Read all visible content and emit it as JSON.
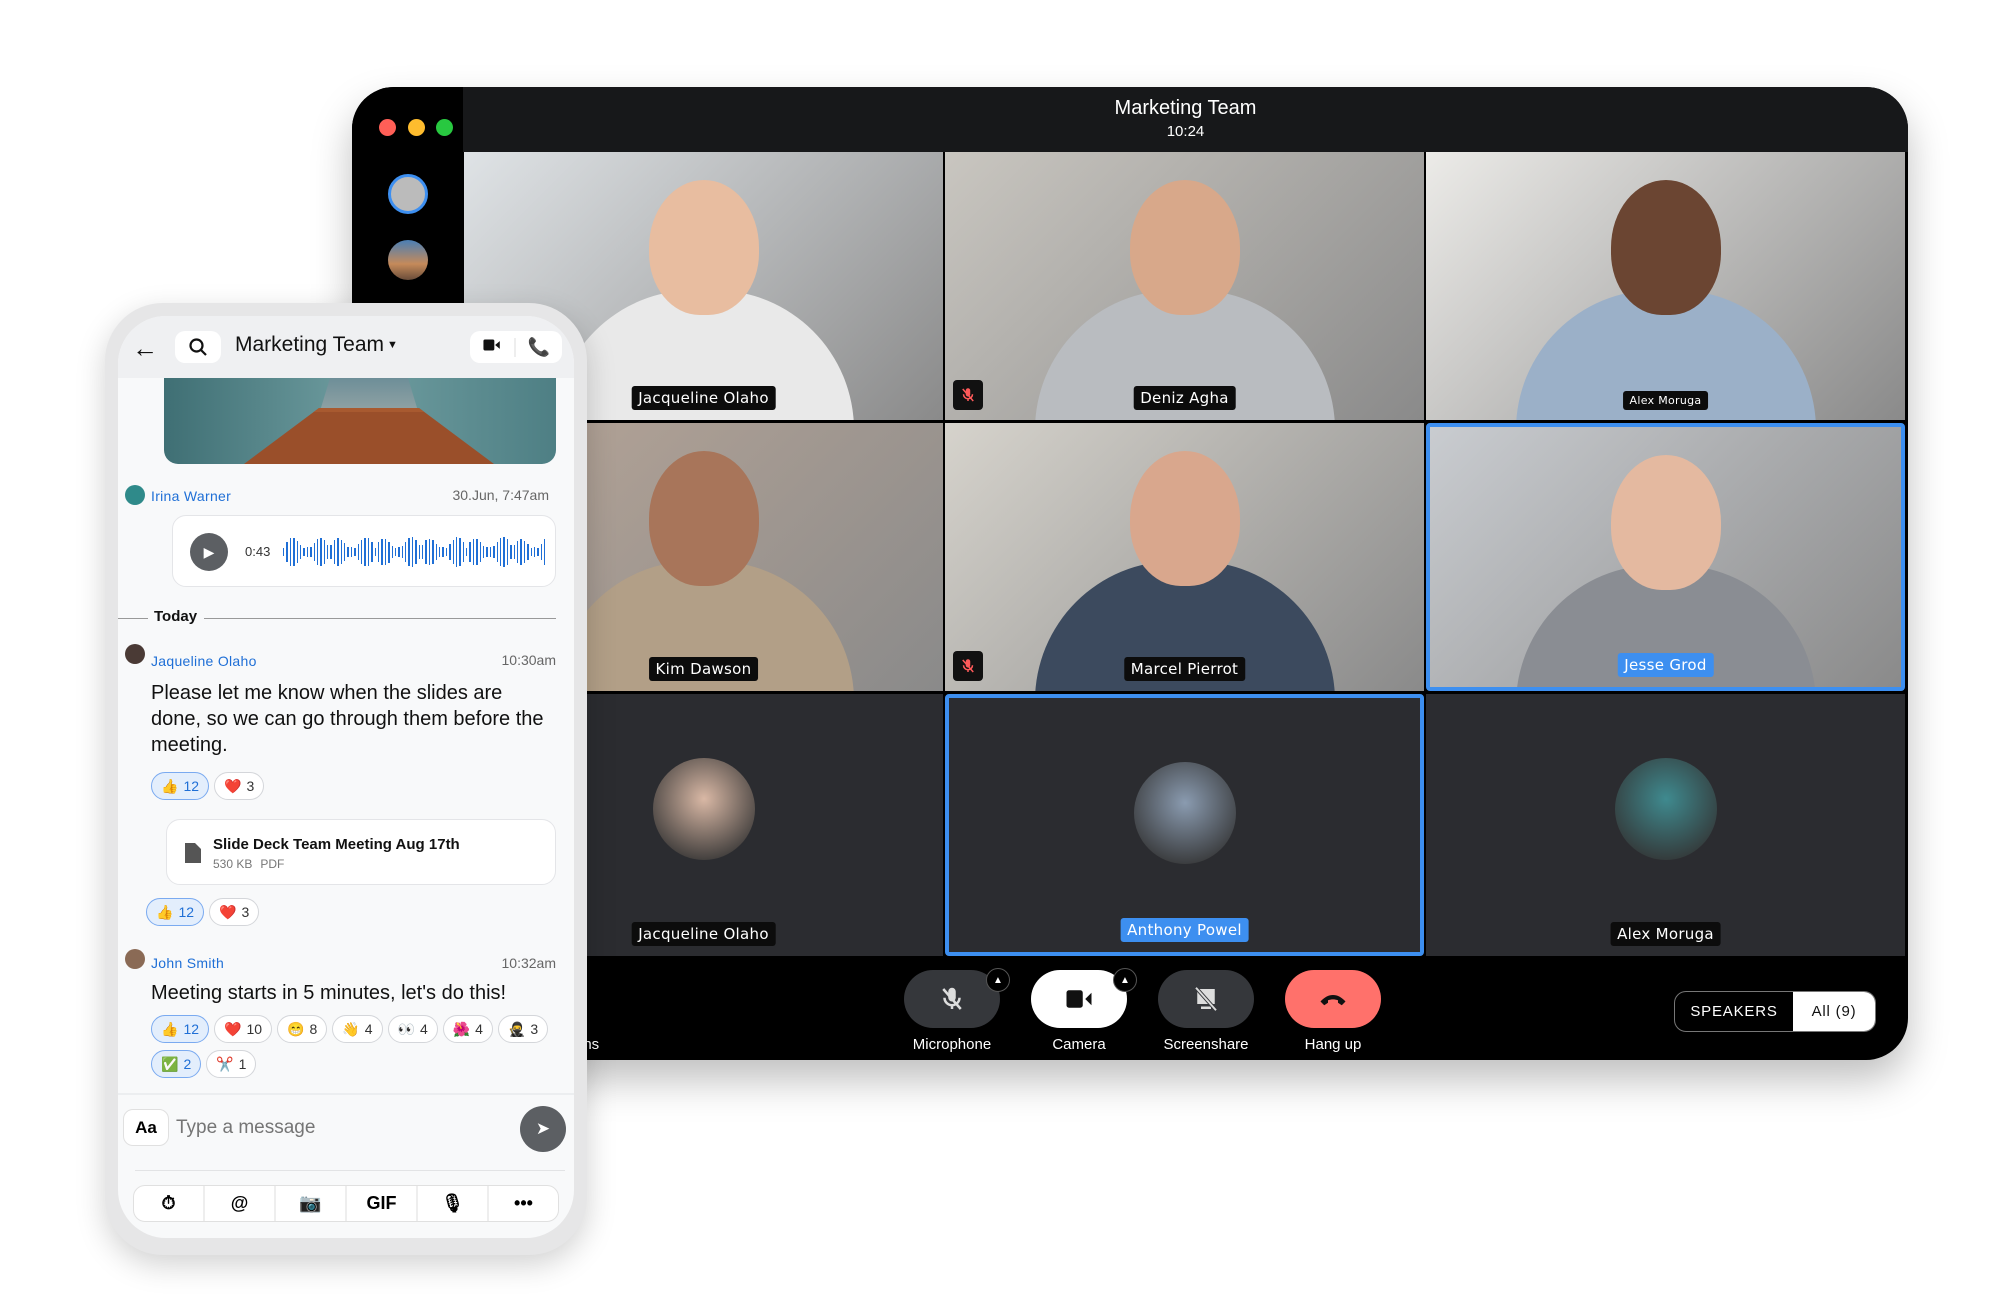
{
  "window": {
    "title": "Marketing Team",
    "time": "10:24",
    "traffic_lights": [
      "#ff5f57",
      "#febc2e",
      "#28c840"
    ]
  },
  "tiles": [
    {
      "name": "Jacqueline Olaho",
      "muted": false,
      "bg": "#dfe3e6",
      "skin": "#e8bda0",
      "shirt": "#e9e9e9"
    },
    {
      "name": "Deniz Agha",
      "muted": true,
      "bg": "#c9c6c0",
      "skin": "#d8a88a",
      "shirt": "#b9bcc0"
    },
    {
      "name": "Alex Moruga",
      "muted": false,
      "bg": "#ecebe8",
      "skin": "#6b4532",
      "shirt": "#9bb0c8"
    },
    {
      "name": "Kim Dawson",
      "muted": false,
      "bg": "#b7a597",
      "skin": "#a8755a",
      "shirt": "#b29f87"
    },
    {
      "name": "Marcel Pierrot",
      "muted": true,
      "bg": "#d6d3cc",
      "skin": "#d9a78d",
      "shirt": "#3c4a5e"
    },
    {
      "name": "Jesse Grod",
      "muted": false,
      "selected": true,
      "bg": "#c9ccd0",
      "skin": "#e4b9a0",
      "shirt": "#8a8d93"
    },
    {
      "name": "Jacqueline Olaho",
      "muted": false,
      "avatar": true,
      "bg": "#2b2c30",
      "avatar_color": "#d9b8a5"
    },
    {
      "name": "Anthony Powel",
      "muted": false,
      "avatar": true,
      "selected": true,
      "bg": "#2b2c30",
      "avatar_color": "#8a9bb0"
    },
    {
      "name": "Alex Moruga",
      "muted": false,
      "avatar": true,
      "bg": "#2b2c30",
      "avatar_color": "#3f8a8f"
    }
  ],
  "controls": {
    "partial_label": "ons",
    "microphone": "Microphone",
    "camera": "Camera",
    "screenshare": "Screenshare",
    "hangup": "Hang up",
    "hangup_color": "#ff716b",
    "accent": "#3d8ff0"
  },
  "view_toggle": {
    "speakers": "SPEAKERS",
    "all": "All (9)",
    "selected": "All (9)"
  },
  "phone": {
    "title": "Marketing Team",
    "messages": [
      {
        "author": "Irina Warner",
        "time": "30.Jun, 7:47am",
        "voice_duration": "0:43"
      },
      {
        "author": "Jaqueline Olaho",
        "time": "10:30am",
        "text": "Please let me know when the slides are done, so we can go through them before the meeting.",
        "reactions": [
          {
            "emoji": "👍",
            "count": "12",
            "mine": true
          },
          {
            "emoji": "❤️",
            "count": "3"
          }
        ],
        "file": {
          "name": "Slide Deck Team Meeting Aug 17th",
          "size": "530 KB",
          "type": "PDF"
        },
        "file_reactions": [
          {
            "emoji": "👍",
            "count": "12",
            "mine": true
          },
          {
            "emoji": "❤️",
            "count": "3"
          }
        ]
      },
      {
        "author": "John Smith",
        "time": "10:32am",
        "text": "Meeting starts in 5 minutes, let's do this!",
        "reactions": [
          {
            "emoji": "👍",
            "count": "12",
            "mine": true
          },
          {
            "emoji": "❤️",
            "count": "10"
          },
          {
            "emoji": "😁",
            "count": "8"
          },
          {
            "emoji": "👋",
            "count": "4"
          },
          {
            "emoji": "👀",
            "count": "4"
          },
          {
            "emoji": "🌺",
            "count": "4"
          },
          {
            "emoji": "🥷",
            "count": "3"
          },
          {
            "emoji": "✅",
            "count": "2",
            "mine": true
          },
          {
            "emoji": "✂️",
            "count": "1"
          }
        ]
      }
    ],
    "divider": "Today",
    "input": {
      "placeholder": "Type a message",
      "format_label": "Aa"
    },
    "toolbar": [
      "timer-icon",
      "mention-icon",
      "camera-icon",
      "GIF",
      "microphone-icon",
      "more-icon"
    ]
  }
}
